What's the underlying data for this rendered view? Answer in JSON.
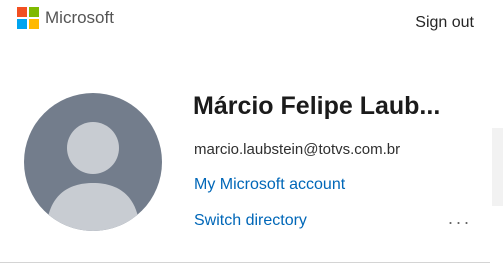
{
  "header": {
    "brand": "Microsoft",
    "sign_out_label": "Sign out",
    "logo_colors": [
      "#f25022",
      "#7fba00",
      "#00a4ef",
      "#ffb900"
    ]
  },
  "profile": {
    "name": "Márcio Felipe Laub...",
    "email": "marcio.laubstein@totvs.com.br",
    "account_link": "My Microsoft account",
    "switch_directory_link": "Switch directory",
    "more_label": "..."
  },
  "colors": {
    "link": "#0067b8",
    "avatar_bg": "#737d8c",
    "avatar_figure": "#c8ccd2"
  }
}
